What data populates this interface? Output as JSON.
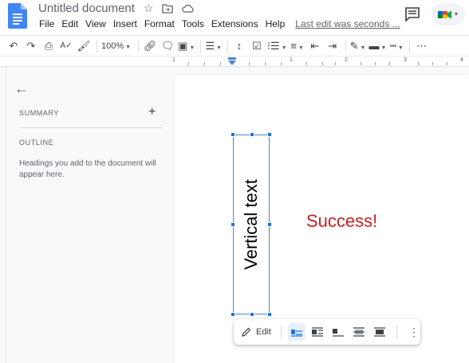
{
  "app": {
    "title": "Untitled document",
    "menus": [
      "File",
      "Edit",
      "View",
      "Insert",
      "Format",
      "Tools",
      "Extensions",
      "Help"
    ],
    "last_edit": "Last edit was seconds ..."
  },
  "toolbar": {
    "zoom": "100%"
  },
  "ruler": {
    "numbers": [
      "1",
      "1",
      "2",
      "3",
      "4"
    ]
  },
  "sidebar": {
    "summary_label": "SUMMARY",
    "outline_label": "OUTLINE",
    "outline_hint": "Headings you add to the document will appear here."
  },
  "document": {
    "drawing_text": "Vertical text",
    "body_text": "Success!",
    "body_text_color": "#c5221f"
  },
  "float_toolbar": {
    "edit_label": "Edit"
  },
  "colors": {
    "accent": "#1a73e8",
    "selection_border": "#4a86c7"
  }
}
